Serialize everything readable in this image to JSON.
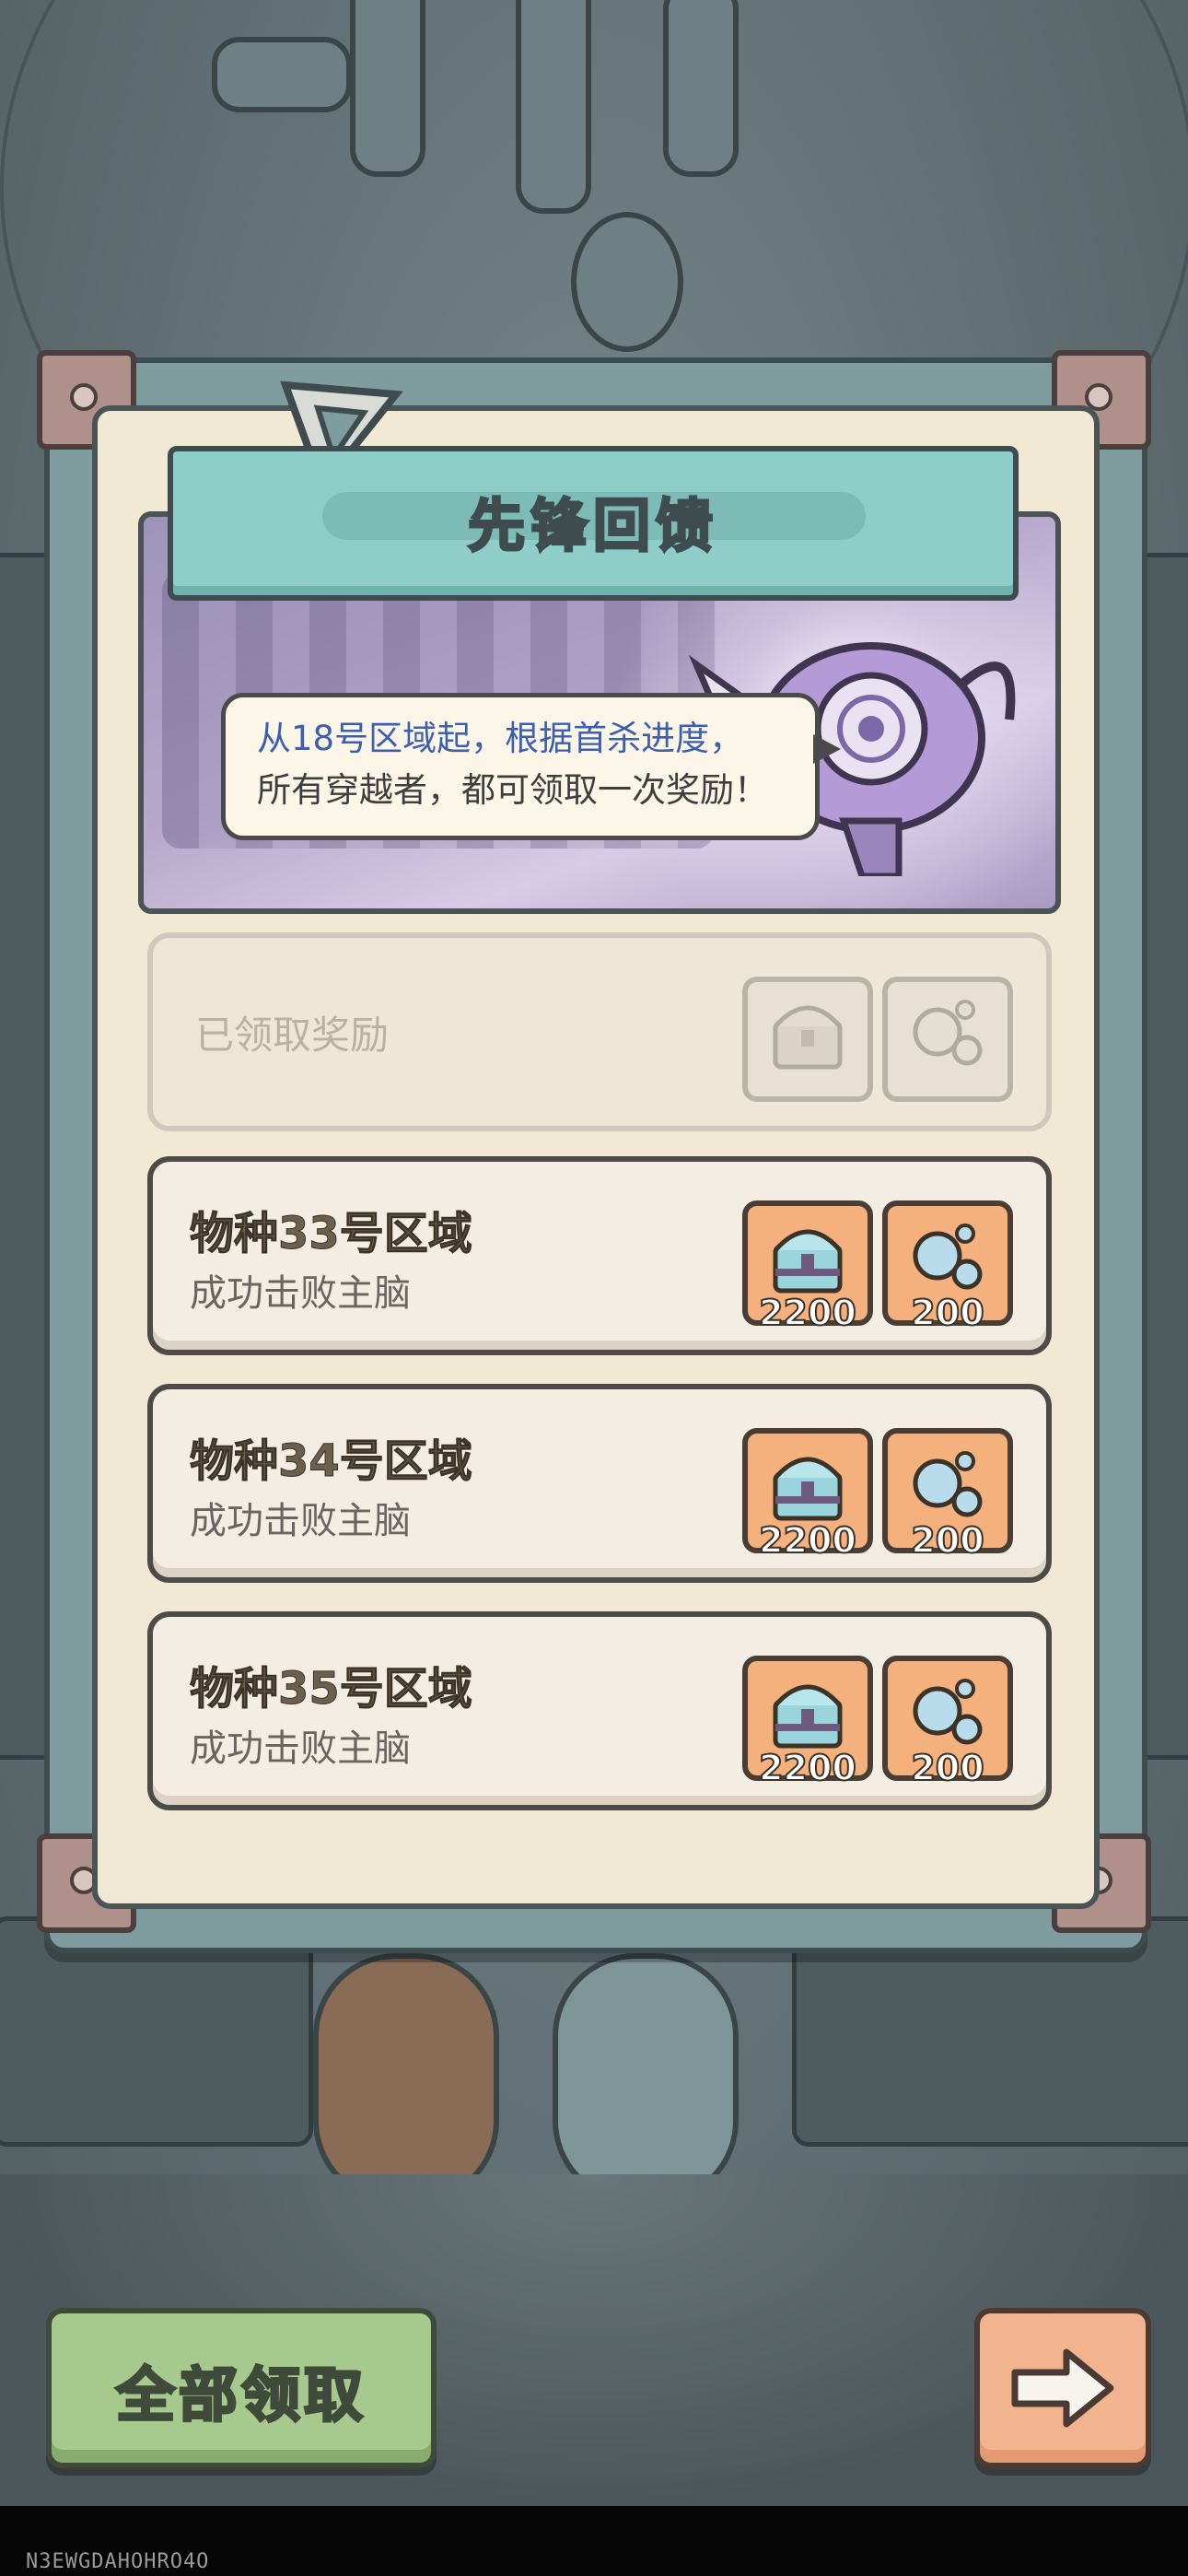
{
  "panel": {
    "title": "先锋回馈",
    "speech_line1": "从18号区域起，根据首杀进度，",
    "speech_line2": "所有穿越者，都可领取一次奖励！"
  },
  "claimed_row": {
    "label": "已领取奖励",
    "rewards": [
      "chest-icon",
      "gem-orbs-icon"
    ]
  },
  "rows": [
    {
      "title": "物种33号区域",
      "subtitle": "成功击败主脑",
      "chest_amount": "2200",
      "gem_amount": "200"
    },
    {
      "title": "物种34号区域",
      "subtitle": "成功击败主脑",
      "chest_amount": "2200",
      "gem_amount": "200"
    },
    {
      "title": "物种35号区域",
      "subtitle": "成功击败主脑",
      "chest_amount": "2200",
      "gem_amount": "200"
    }
  ],
  "buttons": {
    "claim_all": "全部领取",
    "next_icon": "arrow-right-icon"
  },
  "footer": {
    "id": "N3EWGDAHOHRO4O"
  },
  "colors": {
    "title_bar": "#8fcdc8",
    "reward_bg": "#f4b07d",
    "claim_all_bg": "#a6c98e",
    "next_bg": "#f2b48f",
    "speech_blue": "#3d5fae"
  }
}
